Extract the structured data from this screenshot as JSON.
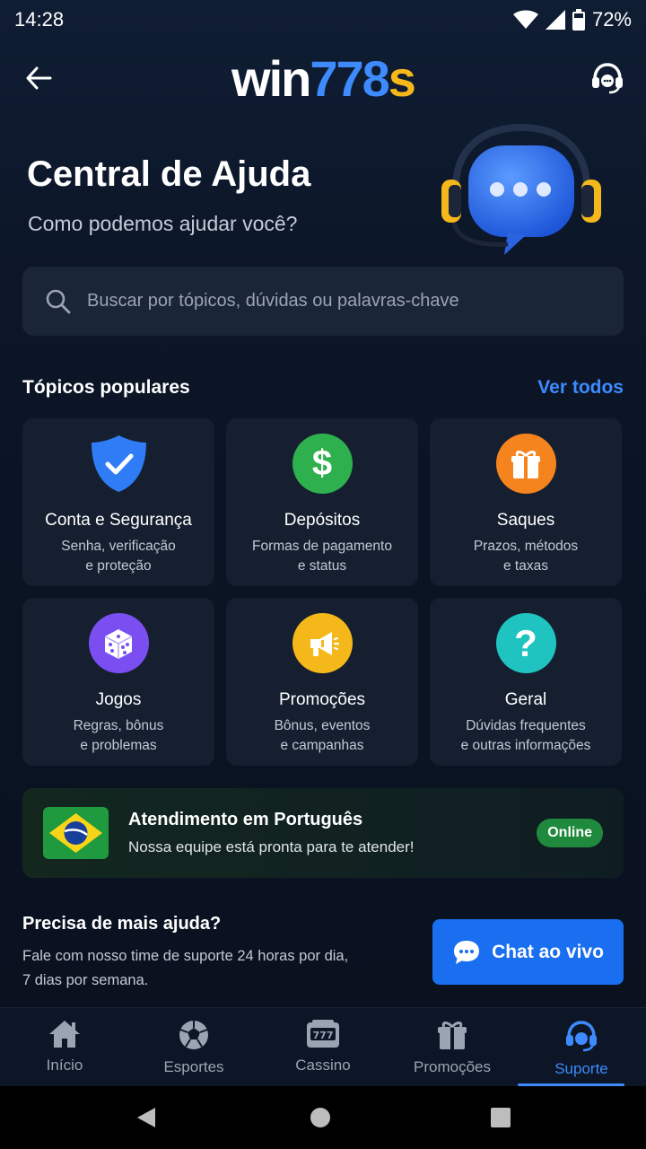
{
  "status_bar": {
    "time": "14:28",
    "battery": "72%"
  },
  "header": {
    "logo_part1": "win",
    "logo_part2": "778",
    "logo_part3": "s"
  },
  "hero": {
    "title": "Central de Ajuda",
    "subtitle": "Como podemos ajudar você?"
  },
  "search": {
    "placeholder": "Buscar por tópicos, dúvidas ou palavras-chave",
    "value": ""
  },
  "topics": {
    "title": "Tópicos populares",
    "see_all": "Ver todos",
    "items": [
      {
        "title": "Conta e Segurança",
        "desc_line1": "Senha, verificação",
        "desc_line2": "e proteção",
        "icon": "shield-check-icon",
        "color": "#2f7cf6"
      },
      {
        "title": "Depósitos",
        "desc_line1": "Formas de pagamento",
        "desc_line2": "e status",
        "icon": "dollar-icon",
        "color": "#2fb04e"
      },
      {
        "title": "Saques",
        "desc_line1": "Prazos, métodos",
        "desc_line2": "e taxas",
        "icon": "gift-icon",
        "color": "#f5841f"
      },
      {
        "title": "Jogos",
        "desc_line1": "Regras, bônus",
        "desc_line2": "e problemas",
        "icon": "dice-icon",
        "color": "#7a4ef0"
      },
      {
        "title": "Promoções",
        "desc_line1": "Bônus, eventos",
        "desc_line2": "e campanhas",
        "icon": "megaphone-icon",
        "color": "#f5b81a"
      },
      {
        "title": "Geral",
        "desc_line1": "Dúvidas frequentes",
        "desc_line2": "e outras informações",
        "icon": "question-icon",
        "color": "#1fc3c0"
      }
    ]
  },
  "language": {
    "title": "Atendimento em Português",
    "subtitle": "Nossa equipe está pronta para te atender!",
    "badge": "Online",
    "flag": "brazil-flag-icon"
  },
  "more_help": {
    "title": "Precisa de mais ajuda?",
    "text_line1": "Fale com nosso time de suporte 24 horas por dia,",
    "text_line2": "7 dias por semana.",
    "chat_button": "Chat ao vivo"
  },
  "bottom_nav": {
    "items": [
      {
        "label": "Início",
        "icon": "home-icon"
      },
      {
        "label": "Esportes",
        "icon": "soccer-ball-icon"
      },
      {
        "label": "Cassino",
        "icon": "slot-machine-icon"
      },
      {
        "label": "Promoções",
        "icon": "gift-icon"
      },
      {
        "label": "Suporte",
        "icon": "headset-icon",
        "active": true
      }
    ]
  },
  "colors": {
    "accent": "#3d8bff",
    "brand_yellow": "#f5b81a",
    "online": "#1f8a3d",
    "background": "#0b1424"
  }
}
